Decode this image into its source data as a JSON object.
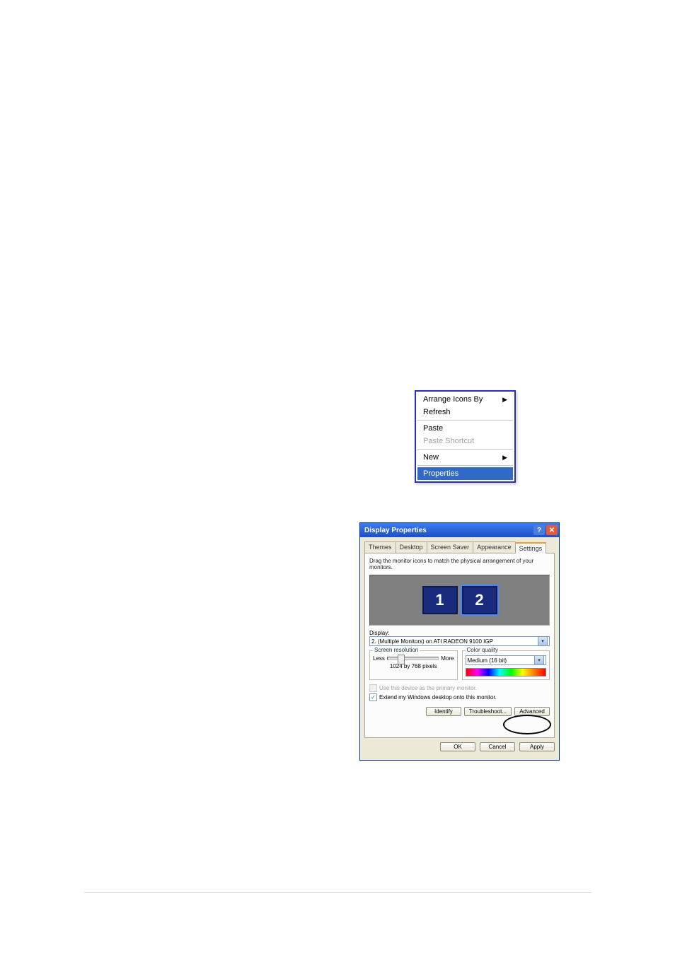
{
  "contextMenu": {
    "items": [
      {
        "label": "Arrange Icons By",
        "hasArrow": true,
        "disabled": false
      },
      {
        "label": "Refresh",
        "hasArrow": false,
        "disabled": false
      },
      "---",
      {
        "label": "Paste",
        "hasArrow": false,
        "disabled": false
      },
      {
        "label": "Paste Shortcut",
        "hasArrow": false,
        "disabled": true
      },
      "---",
      {
        "label": "New",
        "hasArrow": true,
        "disabled": false
      },
      "---",
      {
        "label": "Properties",
        "hasArrow": false,
        "disabled": false,
        "selected": true
      }
    ]
  },
  "dialog": {
    "title": "Display Properties",
    "titlebarHelp": "?",
    "titlebarClose": "✕",
    "tabs": [
      "Themes",
      "Desktop",
      "Screen Saver",
      "Appearance",
      "Settings"
    ],
    "activeTab": "Settings",
    "instruction": "Drag the monitor icons to match the physical arrangement of your monitors.",
    "monitors": [
      "1",
      "2"
    ],
    "selectedMonitorIndex": 1,
    "displayLabel": "Display:",
    "displayValue": "2. (Multiple Monitors) on ATI RADEON 9100 IGP",
    "resolutionGroupTitle": "Screen resolution",
    "sliderLess": "Less",
    "sliderMore": "More",
    "resolutionCaption": "1024 by 768 pixels",
    "colorGroupTitle": "Color quality",
    "colorQualityValue": "Medium (16 bit)",
    "checkPrimaryLabel": "Use this device as the primary monitor.",
    "checkExtendLabel": "Extend my Windows desktop onto this monitor.",
    "extendChecked": "✓",
    "identifyLabel": "Identify",
    "troubleshootLabel": "Troubleshoot...",
    "advancedLabel": "Advanced",
    "okLabel": "OK",
    "cancelLabel": "Cancel",
    "applyLabel": "Apply"
  }
}
